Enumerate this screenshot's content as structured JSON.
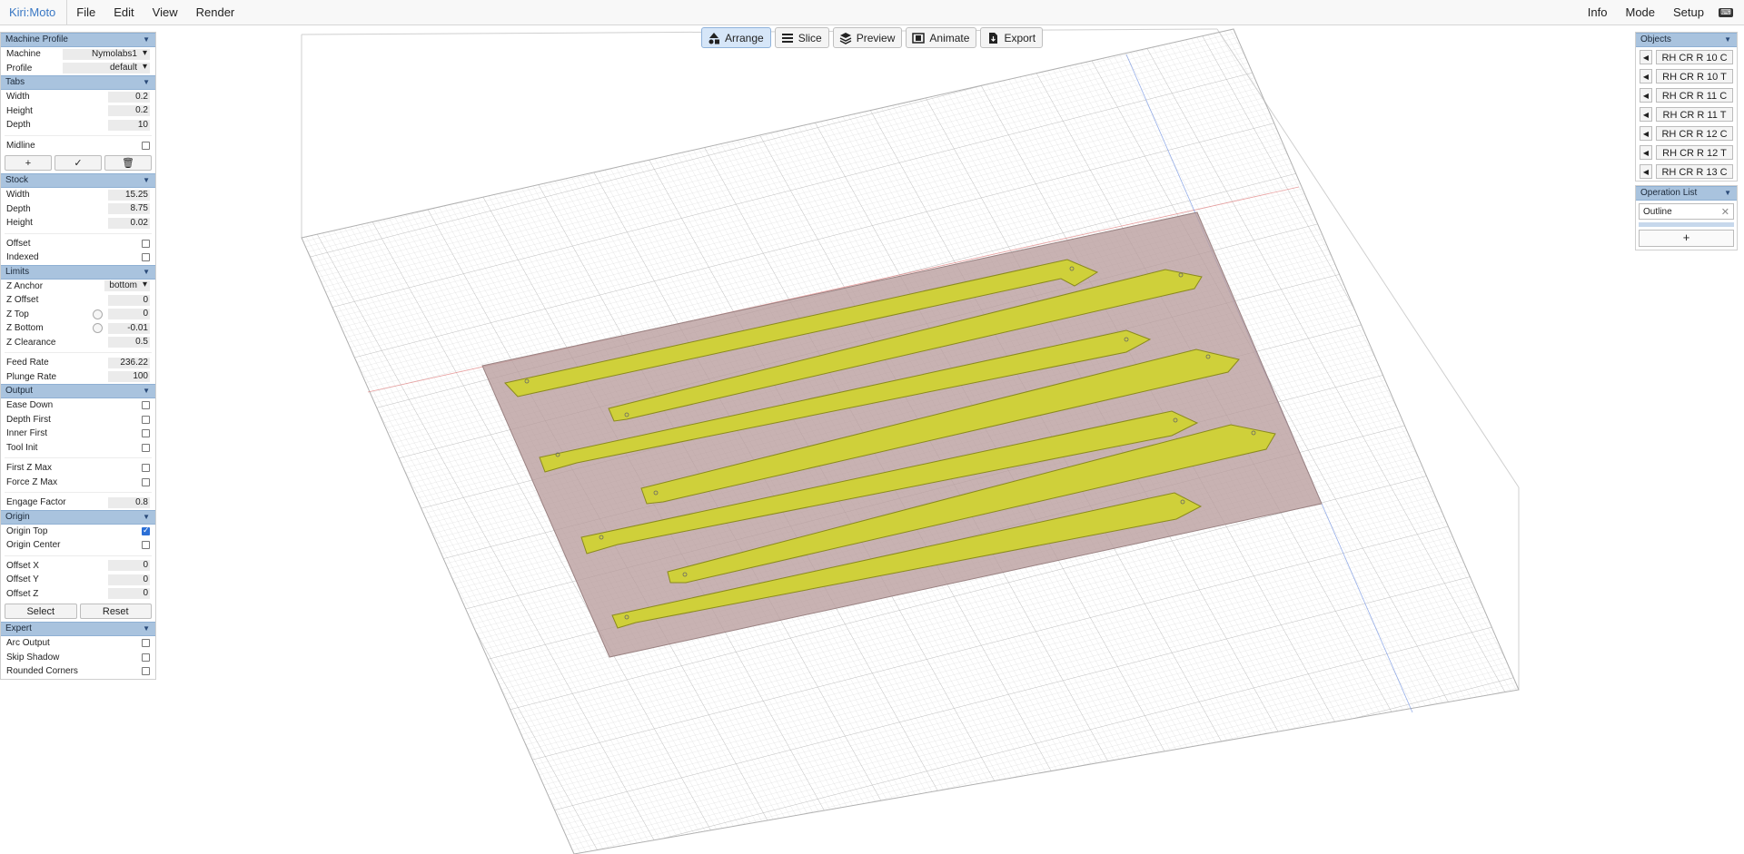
{
  "app": {
    "brand": "Kiri:Moto"
  },
  "menubar": {
    "left_items": [
      "File",
      "Edit",
      "View",
      "Render"
    ],
    "right_items": [
      "Info",
      "Mode",
      "Setup"
    ],
    "keyboard_icon": "keyboard-icon"
  },
  "toolbar": {
    "arrange": "Arrange",
    "slice": "Slice",
    "preview": "Preview",
    "animate": "Animate",
    "export": "Export",
    "active": "Arrange"
  },
  "left": {
    "machine_profile": {
      "title": "Machine Profile",
      "machine_label": "Machine",
      "machine_value": "Nymolabs1",
      "profile_label": "Profile",
      "profile_value": "default"
    },
    "tabs": {
      "title": "Tabs",
      "width_label": "Width",
      "width_value": "0.2",
      "height_label": "Height",
      "height_value": "0.2",
      "depth_label": "Depth",
      "depth_value": "10",
      "midline_label": "Midline"
    },
    "stock": {
      "title": "Stock",
      "width_label": "Width",
      "width_value": "15.25",
      "depth_label": "Depth",
      "depth_value": "8.75",
      "height_label": "Height",
      "height_value": "0.02",
      "offset_label": "Offset",
      "indexed_label": "Indexed"
    },
    "limits": {
      "title": "Limits",
      "z_anchor_label": "Z Anchor",
      "z_anchor_value": "bottom",
      "z_offset_label": "Z Offset",
      "z_offset_value": "0",
      "z_top_label": "Z Top",
      "z_top_value": "0",
      "z_bottom_label": "Z Bottom",
      "z_bottom_value": "-0.01",
      "z_clearance_label": "Z Clearance",
      "z_clearance_value": "0.5",
      "feed_rate_label": "Feed Rate",
      "feed_rate_value": "236.22",
      "plunge_rate_label": "Plunge Rate",
      "plunge_rate_value": "100"
    },
    "output": {
      "title": "Output",
      "ease_down": "Ease Down",
      "depth_first": "Depth First",
      "inner_first": "Inner First",
      "tool_init": "Tool Init",
      "first_z_max": "First Z Max",
      "force_z_max": "Force Z Max",
      "engage_factor_label": "Engage Factor",
      "engage_factor_value": "0.8"
    },
    "origin": {
      "title": "Origin",
      "origin_top": "Origin Top",
      "origin_top_checked": true,
      "origin_center": "Origin Center",
      "offset_x_label": "Offset X",
      "offset_x_value": "0",
      "offset_y_label": "Offset Y",
      "offset_y_value": "0",
      "offset_z_label": "Offset Z",
      "offset_z_value": "0",
      "select_label": "Select",
      "reset_label": "Reset"
    },
    "expert": {
      "title": "Expert",
      "arc_output": "Arc Output",
      "skip_shadow": "Skip Shadow",
      "rounded_corners": "Rounded Corners"
    }
  },
  "right": {
    "objects_title": "Objects",
    "objects": [
      "RH CR R 10 C",
      "RH CR R 10 T",
      "RH CR R 11 C",
      "RH CR R 11 T",
      "RH CR R 12 C",
      "RH CR R 12 T",
      "RH CR R 13 C"
    ],
    "operation_list_title": "Operation List",
    "operations": [
      "Outline"
    ],
    "add_label": "+"
  },
  "colors": {
    "accent": "#3a78c4",
    "section_header": "#a9c3de",
    "stock": "#b89c9c",
    "parts": "#cfd03a"
  }
}
